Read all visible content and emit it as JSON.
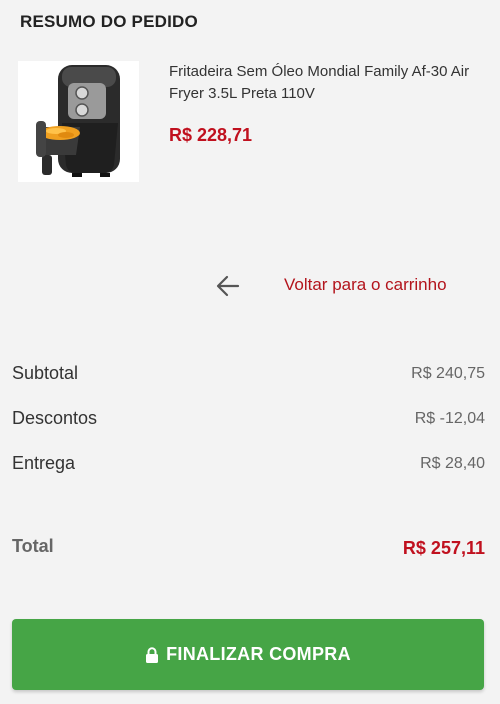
{
  "summary": {
    "title": "RESUMO DO PEDIDO"
  },
  "product": {
    "name": "Fritadeira Sem Óleo Mondial Family Af-30 Air Fryer 3.5L Preta 110V",
    "price": "R$ 228,71",
    "image_icon": "air-fryer-product-image"
  },
  "back": {
    "icon": "arrow-left-icon",
    "label": "Voltar para o carrinho"
  },
  "totals": {
    "subtotal_label": "Subtotal",
    "subtotal_value": "R$ 240,75",
    "discounts_label": "Descontos",
    "discounts_value": "R$ -12,04",
    "shipping_label": "Entrega",
    "shipping_value": "R$ 28,40",
    "total_label": "Total",
    "total_value": "R$ 257,11"
  },
  "checkout": {
    "label": "FINALIZAR COMPRA",
    "icon": "lock-icon"
  },
  "colors": {
    "accent_red": "#c0101e",
    "link_red": "#b3141c",
    "button_green": "#46a546",
    "background": "#f3f3f3"
  }
}
